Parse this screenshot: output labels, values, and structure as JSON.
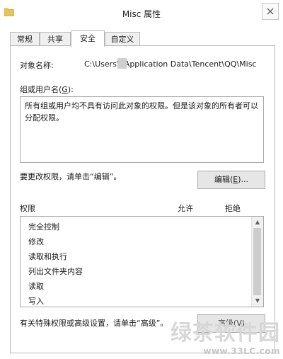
{
  "window": {
    "title": "Misc 属性",
    "colors": {
      "folder_icon": "#e8c35a",
      "border": "#b9b9b9",
      "button_bg": "#e6e6e6",
      "scroll_thumb": "#cdcdcd"
    }
  },
  "tabs": [
    "常规",
    "共享",
    "安全",
    "自定义"
  ],
  "active_tab": "安全",
  "security": {
    "object_name_label": "对象名称:",
    "object_path": "C:\\Users\\      \\Application Data\\Tencent\\QQ\\Misc",
    "group_label_prefix": "组或用户名(",
    "group_label_key": "G",
    "group_label_suffix": "):",
    "group_message": "所有组或用户均不具有访问此对象的权限。但是该对象的所有者可以分配权限。",
    "change_perm_text": "要更改权限，请单击“编辑”。",
    "edit_button_prefix": "编辑(",
    "edit_button_key": "E",
    "edit_button_suffix": ")...",
    "permissions_header": "权限",
    "allow_header": "允许",
    "deny_header": "拒绝",
    "permissions": [
      "完全控制",
      "修改",
      "读取和执行",
      "列出文件夹内容",
      "读取",
      "写入"
    ],
    "advanced_text": "有关特殊权限或高级设置，请单击“高级”。",
    "advanced_button": "高级(V)"
  },
  "watermark": {
    "text": "绿茶软件园",
    "url": "www.33LC.com"
  }
}
